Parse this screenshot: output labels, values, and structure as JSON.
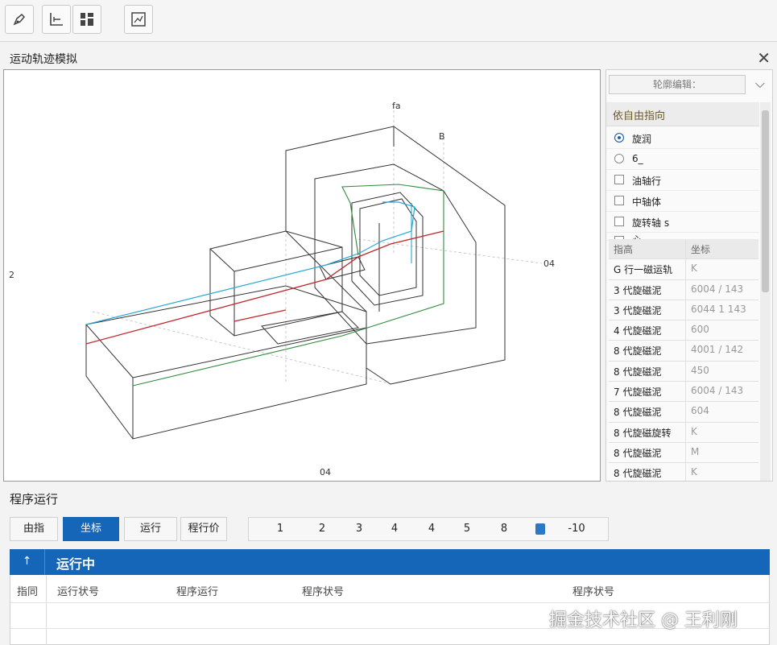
{
  "toolbar": {
    "icons": [
      "pen-tool-icon",
      "axis-icon",
      "grid-layout-icon",
      "chart-frame-icon"
    ]
  },
  "panel": {
    "title": "运动轨迹模拟",
    "close": "✕"
  },
  "viewport": {
    "axis_labels": {
      "top": "fa",
      "right_top": "B",
      "right": "04",
      "left": "2",
      "bottom": "04"
    }
  },
  "right_panel": {
    "dropdown_value": "轮廓编辑：",
    "chevron": "⌵",
    "section_title": "依自由指向",
    "options": [
      {
        "type": "radio",
        "checked": true,
        "label": "旋润"
      },
      {
        "type": "radio",
        "checked": false,
        "label": "6_"
      },
      {
        "type": "checkbox",
        "checked": false,
        "label": "油轴行"
      },
      {
        "type": "checkbox",
        "checked": false,
        "label": "中轴体"
      },
      {
        "type": "checkbox",
        "checked": false,
        "label": "旋转轴  s"
      },
      {
        "type": "checkbox",
        "checked": false,
        "label": "心 …"
      }
    ],
    "table_headers": [
      "指高",
      "坐标"
    ],
    "rows": [
      {
        "name": "G 行一磁运轨",
        "value": "K"
      },
      {
        "name": "3 代旋磁泥",
        "value": "6004 / 143"
      },
      {
        "name": "3 代旋磁泥",
        "value": "6044 1 143"
      },
      {
        "name": "4 代旋磁泥",
        "value": "600"
      },
      {
        "name": "8 代旋磁泥",
        "value": "4001 / 142"
      },
      {
        "name": "8 代旋磁泥",
        "value": "450"
      },
      {
        "name": "7 代旋磁泥",
        "value": "6004 / 143"
      },
      {
        "name": "8 代旋磁泥",
        "value": "604"
      },
      {
        "name": "8 代旋磁旋转",
        "value": "K"
      },
      {
        "name": "8 代旋磁泥",
        "value": "M"
      },
      {
        "name": "8 代旋磁泥",
        "value": "K"
      }
    ]
  },
  "program": {
    "title": "程序运行",
    "tabs": [
      {
        "label": "由指",
        "active": false
      },
      {
        "label": "坐标",
        "active": true
      },
      {
        "label": "运行",
        "active": false
      },
      {
        "label": "程行价",
        "active": false
      }
    ],
    "pages": [
      "1",
      "2",
      "3",
      "4",
      "4",
      "5",
      "8",
      "-10"
    ]
  },
  "run": {
    "up_icon": "↑",
    "title": "运行中",
    "columns": [
      "指同",
      "运行状号",
      "程序运行",
      "程序状号",
      "程序状号"
    ]
  },
  "watermark": "掘金技术社区 @ 王利刚",
  "colors": {
    "accent": "#1565b8",
    "line_blue": "#2aa7d8",
    "line_red": "#c0272d",
    "line_green": "#2e8b3e"
  }
}
